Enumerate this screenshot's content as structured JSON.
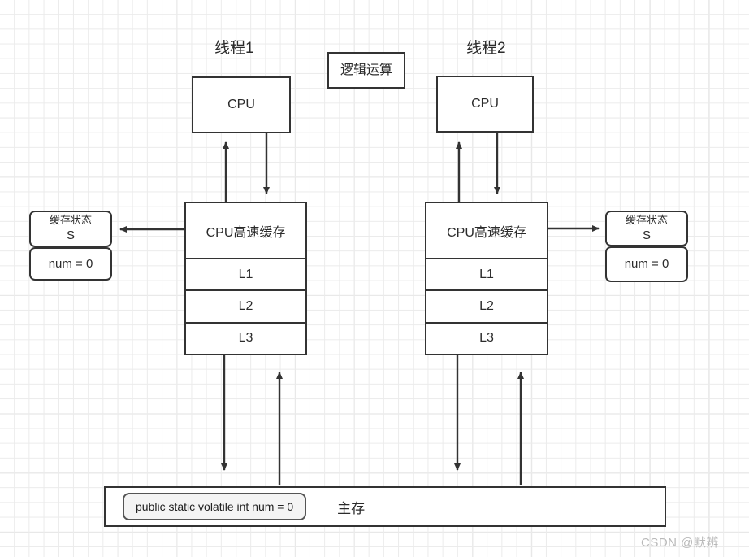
{
  "diagram": {
    "title_left": "线程1",
    "title_right": "线程2",
    "logic_box": "逻辑运算",
    "cpu_label": "CPU",
    "cache_head": "CPU高速缓存",
    "cache_levels": [
      "L1",
      "L2",
      "L3"
    ],
    "status_title": "缓存状态",
    "status_value": "S",
    "status_num": "num = 0",
    "memory_code": "public static volatile int num = 0",
    "memory_label": "主存",
    "watermark": "CSDN @默辨"
  },
  "colors": {
    "stroke": "#333333",
    "grid_minor": "#ebebeb",
    "grid_major": "#e2e2e2",
    "chip_fill": "#f4f4f4",
    "watermark": "#b9b9b9"
  }
}
